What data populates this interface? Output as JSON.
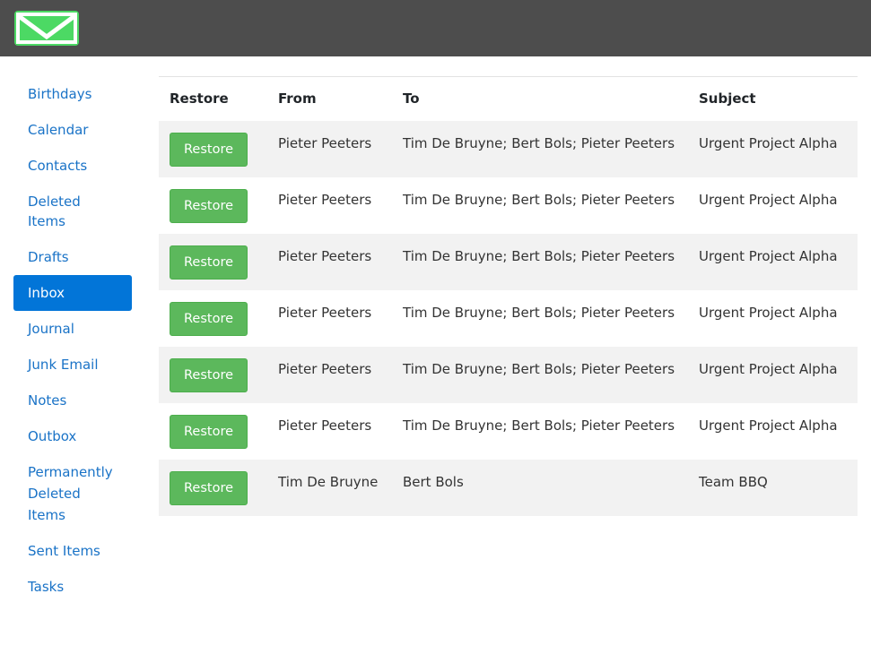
{
  "header": {
    "logo_icon": "mail-envelope-icon",
    "logo_color": "#4cd964"
  },
  "sidebar": {
    "items": [
      {
        "label": "Birthdays"
      },
      {
        "label": "Calendar"
      },
      {
        "label": "Contacts"
      },
      {
        "label": "Deleted Items"
      },
      {
        "label": "Drafts"
      },
      {
        "label": "Inbox",
        "active": true
      },
      {
        "label": "Journal"
      },
      {
        "label": "Junk Email"
      },
      {
        "label": "Notes"
      },
      {
        "label": "Outbox"
      },
      {
        "label": "Permanently Deleted Items"
      },
      {
        "label": "Sent Items"
      },
      {
        "label": "Tasks"
      }
    ],
    "active_color": "#0275d8"
  },
  "table": {
    "headers": {
      "restore": "Restore",
      "from": "From",
      "to": "To",
      "subject": "Subject"
    },
    "button_label": "Restore",
    "button_color": "#5cb85c",
    "rows": [
      {
        "from": "Pieter Peeters",
        "to": "Tim De Bruyne; Bert Bols; Pieter Peeters",
        "subject": "Urgent Project Alpha"
      },
      {
        "from": "Pieter Peeters",
        "to": "Tim De Bruyne; Bert Bols; Pieter Peeters",
        "subject": "Urgent Project Alpha"
      },
      {
        "from": "Pieter Peeters",
        "to": "Tim De Bruyne; Bert Bols; Pieter Peeters",
        "subject": "Urgent Project Alpha"
      },
      {
        "from": "Pieter Peeters",
        "to": "Tim De Bruyne; Bert Bols; Pieter Peeters",
        "subject": "Urgent Project Alpha"
      },
      {
        "from": "Pieter Peeters",
        "to": "Tim De Bruyne; Bert Bols; Pieter Peeters",
        "subject": "Urgent Project Alpha"
      },
      {
        "from": "Pieter Peeters",
        "to": "Tim De Bruyne; Bert Bols; Pieter Peeters",
        "subject": "Urgent Project Alpha"
      },
      {
        "from": "Tim De Bruyne",
        "to": "Bert Bols",
        "subject": "Team BBQ"
      }
    ]
  }
}
